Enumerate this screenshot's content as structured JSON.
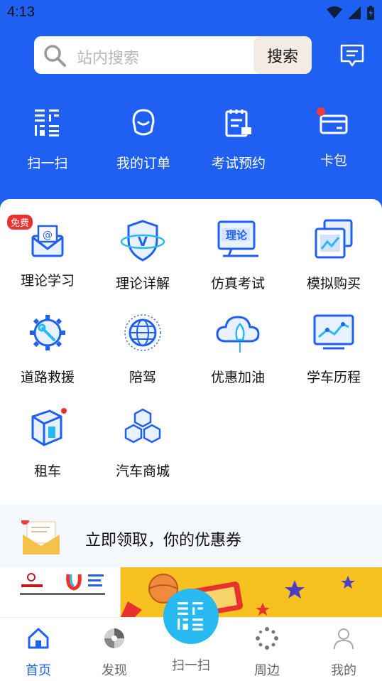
{
  "status": {
    "time": "4:13"
  },
  "search": {
    "placeholder": "站内搜索",
    "button": "搜索"
  },
  "quick": [
    {
      "label": "扫一扫",
      "icon": "scan-icon"
    },
    {
      "label": "我的订单",
      "icon": "orders-icon"
    },
    {
      "label": "考试预约",
      "icon": "exam-booking-icon"
    },
    {
      "label": "卡包",
      "icon": "card-wallet-icon"
    }
  ],
  "grid": [
    {
      "label": "理论学习",
      "icon": "theory-study-icon",
      "badge": "免费"
    },
    {
      "label": "理论详解",
      "icon": "theory-explain-icon"
    },
    {
      "label": "仿真考试",
      "icon": "simulation-exam-icon"
    },
    {
      "label": "模拟购买",
      "icon": "mock-purchase-icon"
    },
    {
      "label": "道路救援",
      "icon": "road-rescue-icon"
    },
    {
      "label": "陪驾",
      "icon": "accompany-drive-icon"
    },
    {
      "label": "优惠加油",
      "icon": "fuel-discount-icon"
    },
    {
      "label": "学车历程",
      "icon": "learning-progress-icon"
    },
    {
      "label": "租车",
      "icon": "car-rental-icon"
    },
    {
      "label": "汽车商城",
      "icon": "car-mall-icon"
    }
  ],
  "coupon": {
    "text": "立即领取，你的优惠券"
  },
  "tabs": [
    {
      "label": "首页",
      "icon": "home-icon"
    },
    {
      "label": "发现",
      "icon": "discover-icon"
    },
    {
      "label": "扫一扫",
      "icon": "scan-icon"
    },
    {
      "label": "周边",
      "icon": "nearby-icon"
    },
    {
      "label": "我的",
      "icon": "profile-icon"
    }
  ],
  "colors": {
    "primary": "#1f5ff2",
    "scan_button": "#27b9f0",
    "badge": "#e8322e",
    "banner": "#f7c21f"
  }
}
